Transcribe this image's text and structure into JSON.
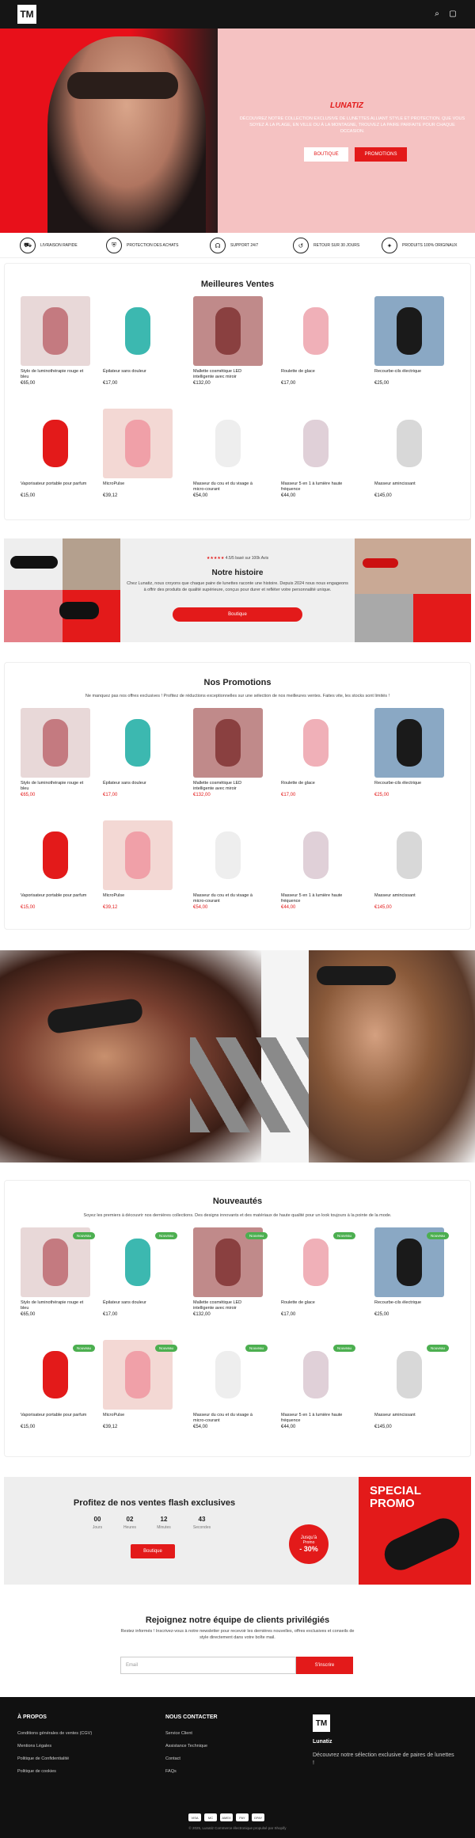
{
  "header": {
    "logo": "TM",
    "icons": [
      "search-icon",
      "cart-icon"
    ]
  },
  "hero": {
    "title": "LUNATIZ",
    "description": "DÉCOUVREZ NOTRE COLLECTION EXCLUSIVE DE LUNETTES ALLIANT STYLE ET PROTECTION. QUE VOUS SOYEZ À LA PLAGE, EN VILLE OU À LA MONTAGNE, TROUVEZ LA PAIRE PARFAITE POUR CHAQUE OCCASION.",
    "btn_boutique": "BOUTIQUE",
    "btn_promotions": "PROMOTIONS"
  },
  "features": [
    {
      "icon": "truck-icon",
      "label": "LIVRAISON RAPIDE"
    },
    {
      "icon": "shield-icon",
      "label": "PROTECTION DES ACHATS"
    },
    {
      "icon": "headset-icon",
      "label": "SUPPORT 24/7"
    },
    {
      "icon": "return-icon",
      "label": "RETOUR SUR 30 JOURS"
    },
    {
      "icon": "badge-icon",
      "label": "PRODUITS 100% ORIGINAUX"
    }
  ],
  "bestsellers": {
    "title": "Meilleures Ventes"
  },
  "products": [
    {
      "name": "Stylo de luminothérapie rouge et bleu",
      "price": "€65,00"
    },
    {
      "name": "Épilateur sans douleur",
      "price": "€17,00"
    },
    {
      "name": "Mallette cosmétique LED intelligente avec miroir",
      "price": "€132,00"
    },
    {
      "name": "Roulette de glace",
      "price": "€17,00"
    },
    {
      "name": "Recourbe-cils électrique",
      "price": "€25,00"
    },
    {
      "name": "Vaporisateur portable pour parfum",
      "price": "€15,00"
    },
    {
      "name": "MicroPulse",
      "price": "€39,12"
    },
    {
      "name": "Masseur du cou et du visage à micro-courant",
      "price": "€54,00"
    },
    {
      "name": "Masseur 5 en 1 à lumière haute fréquence",
      "price": "€44,00"
    },
    {
      "name": "Masseur amincissant",
      "price": "€145,00"
    }
  ],
  "story": {
    "rating": "4.5/5 basé sur 100k Avis",
    "title": "Notre histoire",
    "description": "Chez Lunatiz, nous croyons que chaque paire de lunettes raconte une histoire. Depuis 2024 nous nous engageons à offrir des produits de qualité supérieure, conçus pour durer et refléter votre personnalité unique.",
    "button": "Boutique"
  },
  "promos": {
    "title": "Nos Promotions",
    "subtitle": "Ne manquez pas nos offres exclusives ! Profitez de réductions exceptionnelles sur une sélection de nos meilleures ventes. Faites vite, les stocks sont limités !"
  },
  "news": {
    "title": "Nouveautés",
    "subtitle": "Soyez les premiers à découvrir nos dernières collections. Des designs innovants et des matériaux de haute qualité pour un look toujours à la pointe de la mode.",
    "badge": "Nouveau"
  },
  "flash": {
    "title": "Profitez de nos ventes flash exclusives",
    "countdown": [
      {
        "num": "00",
        "label": "Jours"
      },
      {
        "num": "02",
        "label": "Heures"
      },
      {
        "num": "12",
        "label": "Minutes"
      },
      {
        "num": "43",
        "label": "Secondes"
      }
    ],
    "button": "Boutique",
    "circle_top": "Jusqu'à",
    "circle_mid": "Promo",
    "circle_pct": "- 30%",
    "promo_text": "SPECIAL PROMO"
  },
  "newsletter": {
    "title": "Rejoignez notre équipe de clients privilégiés",
    "description": "Restez informés ! Inscrivez-vous à notre newsletter pour recevoir les dernières nouvelles, offres exclusives et conseils de style directement dans votre boîte mail.",
    "placeholder": "Email",
    "button": "S'inscrire"
  },
  "footer": {
    "about_title": "À PROPOS",
    "about_links": [
      "Conditions générales de ventes (CGV)",
      "Mentions Légales",
      "Politique de Confidentialité",
      "Politique de cookies"
    ],
    "contact_title": "NOUS CONTACTER",
    "contact_links": [
      "Service Client",
      "Assistance Technique",
      "Contact",
      "FAQs"
    ],
    "brand_logo": "TM",
    "brand_name": "Lunatiz",
    "brand_desc": "Découvrez notre sélection exclusive de paires de lunettes !",
    "payments": [
      "VISA",
      "MC",
      "AMEX",
      "PAY",
      "GPAY"
    ],
    "copyright": "© 2025, Lunatiz Commerce électronique propulsé par Shopify"
  },
  "colors": {
    "accent": "#e31a1a",
    "dark": "#151515"
  }
}
